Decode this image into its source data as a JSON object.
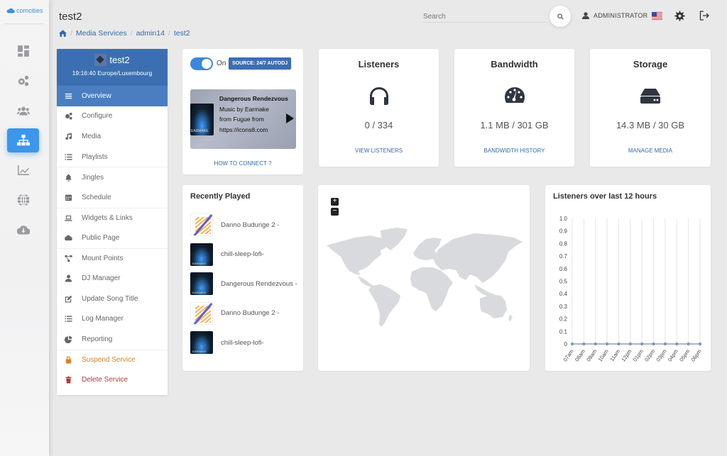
{
  "brand": {
    "logo_text": "comcities"
  },
  "rail": {
    "items": [
      {
        "name": "dashboard",
        "icon": "dashboard-icon"
      },
      {
        "name": "settings",
        "icon": "cogs-icon"
      },
      {
        "name": "users",
        "icon": "users-icon"
      },
      {
        "name": "services",
        "icon": "sitemap-icon",
        "active": true
      },
      {
        "name": "stats",
        "icon": "chart-line-icon"
      },
      {
        "name": "network",
        "icon": "globe-icon"
      },
      {
        "name": "download",
        "icon": "cloud-download-icon"
      }
    ]
  },
  "header": {
    "title": "test2",
    "breadcrumb": [
      "Media Services",
      "admin14",
      "test2"
    ],
    "search_placeholder": "Search",
    "user_label": "ADMINISTRATOR"
  },
  "service_menu": {
    "name": "test2",
    "time": "19:16:40 Europe/Luxembourg",
    "items": [
      {
        "label": "Overview",
        "icon": "bars-icon",
        "active": true
      },
      {
        "label": "Configure",
        "icon": "cogs-icon"
      },
      {
        "label": "Media",
        "icon": "music-icon"
      },
      {
        "label": "Playlists",
        "icon": "list-icon"
      },
      {
        "label": "Jingles",
        "icon": "bell-icon"
      },
      {
        "label": "Schedule",
        "icon": "calendar-icon"
      },
      {
        "label": "Widgets & Links",
        "icon": "laptop-code-icon"
      },
      {
        "label": "Public Page",
        "icon": "cloud-icon"
      },
      {
        "label": "Mount Points",
        "icon": "project-diagram-icon"
      },
      {
        "label": "DJ Manager",
        "icon": "user-icon"
      },
      {
        "label": "Update Song Title",
        "icon": "edit-icon"
      },
      {
        "label": "Log Manager",
        "icon": "list-icon"
      },
      {
        "label": "Reporting",
        "icon": "chart-pie-icon"
      },
      {
        "label": "Suspend Service",
        "icon": "lock-icon",
        "tone": "warning"
      },
      {
        "label": "Delete Service",
        "icon": "trash-icon",
        "tone": "danger"
      }
    ]
  },
  "player": {
    "toggle_label": "On",
    "toggle_on": true,
    "source_badge": "SOURCE: 24/7 AUTODJ",
    "track_title": "Dangerous Rendezvous",
    "track_lines": [
      "Music by Earmake",
      "from Fugue from",
      "https://icons8.com"
    ],
    "art_label": "EARMAKE",
    "how_to_connect": "HOW TO CONNECT ?"
  },
  "stats": [
    {
      "title": "Listeners",
      "icon": "headphones-icon",
      "value": "0 / 334",
      "link": "VIEW LISTENERS"
    },
    {
      "title": "Bandwidth",
      "icon": "tachometer-icon",
      "value": "1.1 MB / 301 GB",
      "link": "BANDWIDTH HISTORY"
    },
    {
      "title": "Storage",
      "icon": "hdd-icon",
      "value": "14.3 MB / 30 GB",
      "link": "MANAGE MEDIA"
    }
  ],
  "recently_played": {
    "title": "Recently Played",
    "items": [
      {
        "title": "Danno Budunge 2 -",
        "art": "dj"
      },
      {
        "title": "chill-sleep-lofi-",
        "art": "earmake"
      },
      {
        "title": "Dangerous Rendezvous -",
        "art": "earmake"
      },
      {
        "title": "Danno Budunge 2 -",
        "art": "dj"
      },
      {
        "title": "chill-sleep-lofi-",
        "art": "earmake"
      }
    ]
  },
  "map": {
    "zoom_in": "+",
    "zoom_out": "−"
  },
  "colors": {
    "primary": "#3b6fb2",
    "accent": "#3d96e8",
    "warning": "#d4822b",
    "danger": "#b9393b"
  },
  "chart_data": {
    "type": "line",
    "title": "Listeners over last 12 hours",
    "categories": [
      "07am",
      "08am",
      "09am",
      "10am",
      "11am",
      "12pm",
      "01pm",
      "02pm",
      "03pm",
      "04pm",
      "05pm",
      "06pm"
    ],
    "series": [
      {
        "name": "Listeners",
        "values": [
          0,
          0,
          0,
          0,
          0,
          0,
          0,
          0,
          0,
          0,
          0,
          0
        ]
      }
    ],
    "yticks": [
      "0",
      "0.1",
      "0.2",
      "0.3",
      "0.4",
      "0.5",
      "0.6",
      "0.7",
      "0.8",
      "0.9",
      "1.0"
    ],
    "ylim": [
      0,
      1
    ],
    "xlabel": "",
    "ylabel": "",
    "grid": "vertical",
    "legend": "none"
  }
}
